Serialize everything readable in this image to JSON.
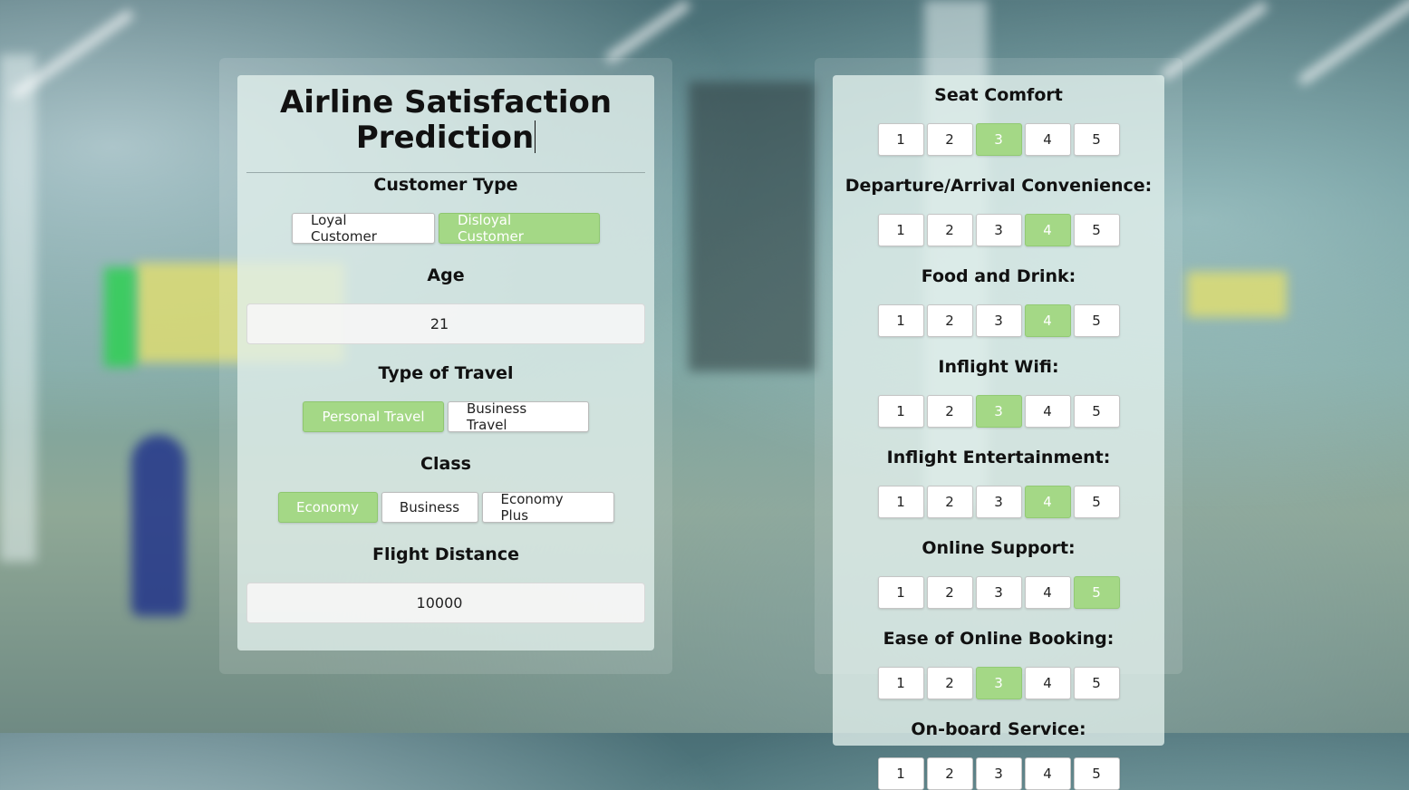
{
  "form": {
    "title": "Airline Satisfaction Prediction",
    "customer_type": {
      "label": "Customer Type",
      "options": [
        "Loyal Customer",
        "Disloyal Customer"
      ],
      "selected": "Disloyal Customer"
    },
    "age": {
      "label": "Age",
      "value": "21"
    },
    "type_of_travel": {
      "label": "Type of Travel",
      "options": [
        "Personal Travel",
        "Business Travel"
      ],
      "selected": "Personal Travel"
    },
    "class": {
      "label": "Class",
      "options": [
        "Economy",
        "Business",
        "Economy Plus"
      ],
      "selected": "Economy"
    },
    "flight_distance": {
      "label": "Flight Distance",
      "value": "10000"
    }
  },
  "ratings": {
    "scale": [
      "1",
      "2",
      "3",
      "4",
      "5"
    ],
    "items": [
      {
        "label": "Seat Comfort",
        "selected": "3"
      },
      {
        "label": "Departure/Arrival Convenience:",
        "selected": "4"
      },
      {
        "label": "Food and Drink:",
        "selected": "4"
      },
      {
        "label": "Inflight Wifi:",
        "selected": "3"
      },
      {
        "label": "Inflight Entertainment:",
        "selected": "4"
      },
      {
        "label": "Online Support:",
        "selected": "5"
      },
      {
        "label": "Ease of Online Booking:",
        "selected": "3"
      },
      {
        "label": "On-board Service:",
        "selected": ""
      }
    ]
  },
  "colors": {
    "selected": "#a4d886",
    "panel": "#e1f0ec"
  }
}
